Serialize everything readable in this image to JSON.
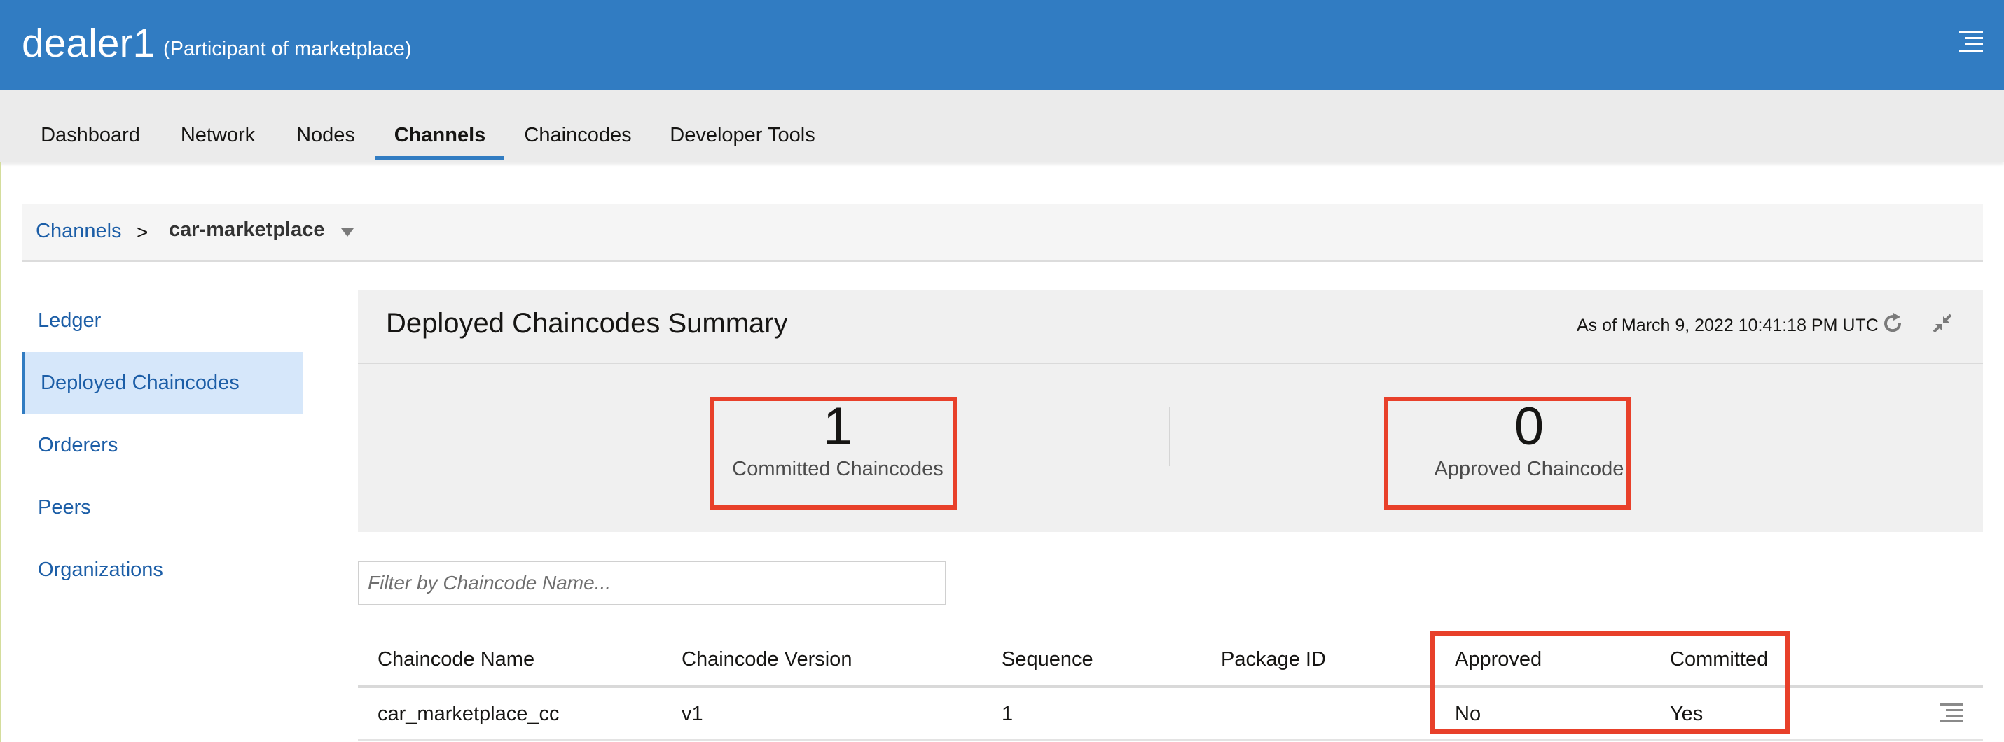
{
  "header": {
    "title": "dealer1",
    "subtitle": "(Participant of marketplace)",
    "menu_icon": "hamburger-menu-icon",
    "background": "#317cc2"
  },
  "nav": {
    "tabs": [
      {
        "label": "Dashboard",
        "active": false
      },
      {
        "label": "Network",
        "active": false
      },
      {
        "label": "Nodes",
        "active": false
      },
      {
        "label": "Channels",
        "active": true
      },
      {
        "label": "Chaincodes",
        "active": false
      },
      {
        "label": "Developer Tools",
        "active": false
      }
    ]
  },
  "breadcrumb": {
    "root": "Channels",
    "separator": ">",
    "current": "car-marketplace"
  },
  "sidebar": {
    "items": [
      {
        "label": "Ledger",
        "active": false
      },
      {
        "label": "Deployed Chaincodes",
        "active": true
      },
      {
        "label": "Orderers",
        "active": false
      },
      {
        "label": "Peers",
        "active": false
      },
      {
        "label": "Organizations",
        "active": false
      }
    ]
  },
  "summary": {
    "title": "Deployed Chaincodes Summary",
    "as_of": "As of March 9, 2022 10:41:18 PM UTC",
    "refresh_icon": "refresh-icon",
    "collapse_icon": "collapse-icon",
    "committed": {
      "value": "1",
      "label": "Committed Chaincodes"
    },
    "approved": {
      "value": "0",
      "label": "Approved Chaincode"
    }
  },
  "filter": {
    "placeholder": "Filter by Chaincode Name...",
    "value": ""
  },
  "table": {
    "columns": [
      "Chaincode Name",
      "Chaincode Version",
      "Sequence",
      "Package ID",
      "Approved",
      "Committed"
    ],
    "rows": [
      {
        "name": "car_marketplace_cc",
        "version": "v1",
        "sequence": "1",
        "package_id": "",
        "approved": "No",
        "committed": "Yes"
      }
    ],
    "row_menu_icon": "row-actions-icon"
  },
  "highlight_color": "#e8402a"
}
